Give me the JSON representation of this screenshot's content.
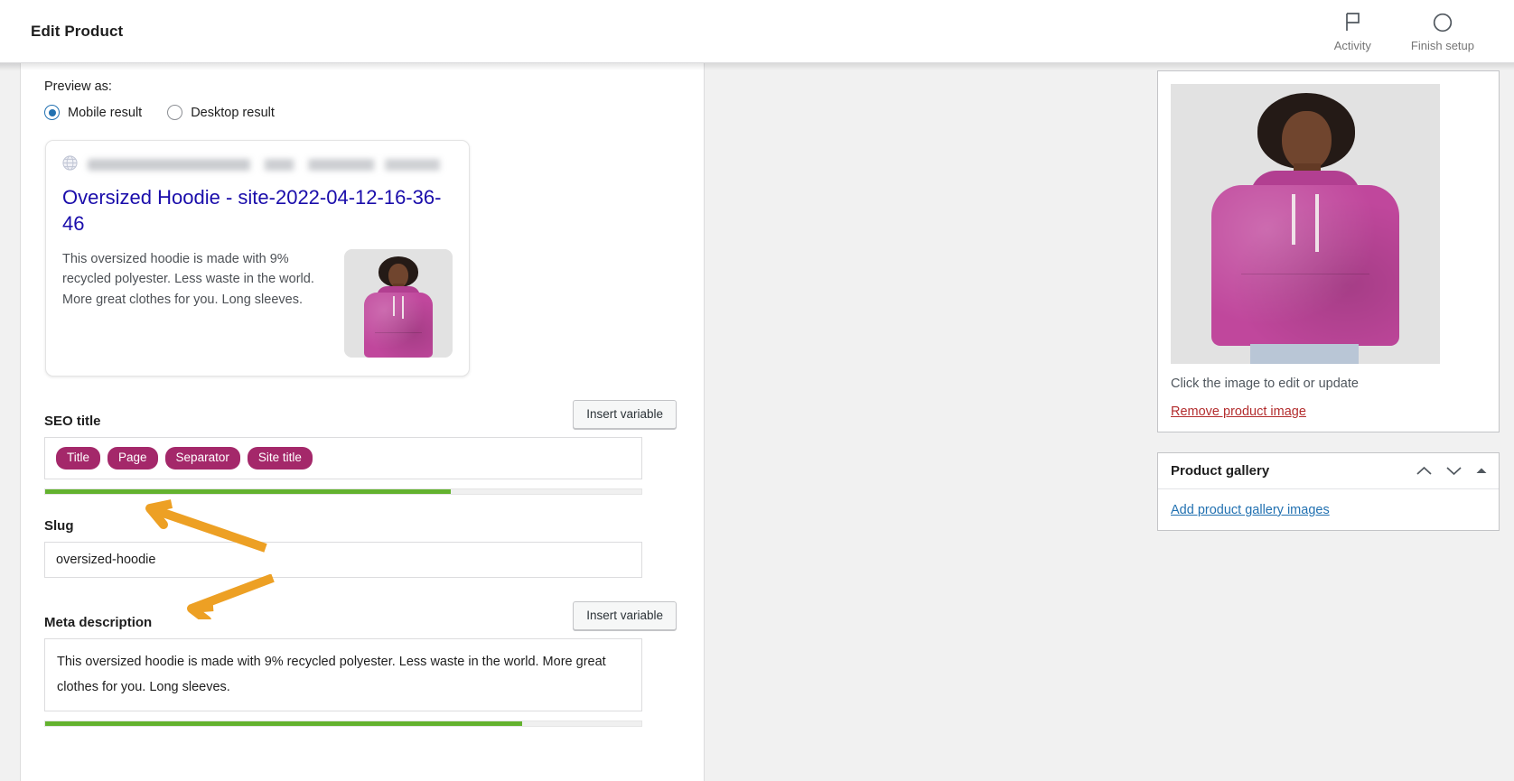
{
  "header": {
    "title": "Edit Product",
    "actions": [
      {
        "label": "Activity",
        "icon": "flag-icon"
      },
      {
        "label": "Finish setup",
        "icon": "circle-icon"
      }
    ]
  },
  "editor": {
    "preview_as_label": "Preview as:",
    "preview_options": [
      {
        "label": "Mobile result",
        "selected": true
      },
      {
        "label": "Desktop result",
        "selected": false
      }
    ],
    "serp_preview": {
      "url_icon": "globe-icon",
      "url_text": "",
      "title": "Oversized Hoodie - site-2022-04-12-16-36-46",
      "description": "This oversized hoodie is made with 9% recycled polyester. Less waste in the world. More great clothes for you. Long sleeves.",
      "thumbnail_alt": "product-thumbnail"
    },
    "seo_title": {
      "label": "SEO title",
      "insert_variable_label": "Insert variable",
      "chips": [
        "Title",
        "Page",
        "Separator",
        "Site title"
      ],
      "progress_percent": 68,
      "progress_color": "#63b22e"
    },
    "slug": {
      "label": "Slug",
      "value": "oversized-hoodie"
    },
    "meta_description": {
      "label": "Meta description",
      "insert_variable_label": "Insert variable",
      "value": "This oversized hoodie is made with 9% recycled polyester. Less waste in the world. More great clothes for you. Long sleeves.",
      "progress_percent": 80,
      "progress_color": "#63b22e"
    }
  },
  "sidebar": {
    "product_image_panel": {
      "caption": "Click the image to edit or update",
      "remove_link": "Remove product image",
      "remove_link_color": "#b32d2e"
    },
    "product_gallery_panel": {
      "title": "Product gallery",
      "controls": [
        {
          "icon": "chevron-up-icon"
        },
        {
          "icon": "chevron-down-icon"
        },
        {
          "icon": "caret-up-icon"
        }
      ],
      "add_link": "Add product gallery images",
      "add_link_color": "#2271b1"
    }
  },
  "annotations": {
    "arrow_color": "#eda024",
    "arrows": [
      {
        "name": "arrow-to-slug",
        "points_to": "Slug"
      },
      {
        "name": "arrow-to-meta-description",
        "points_to": "Meta description"
      }
    ]
  }
}
